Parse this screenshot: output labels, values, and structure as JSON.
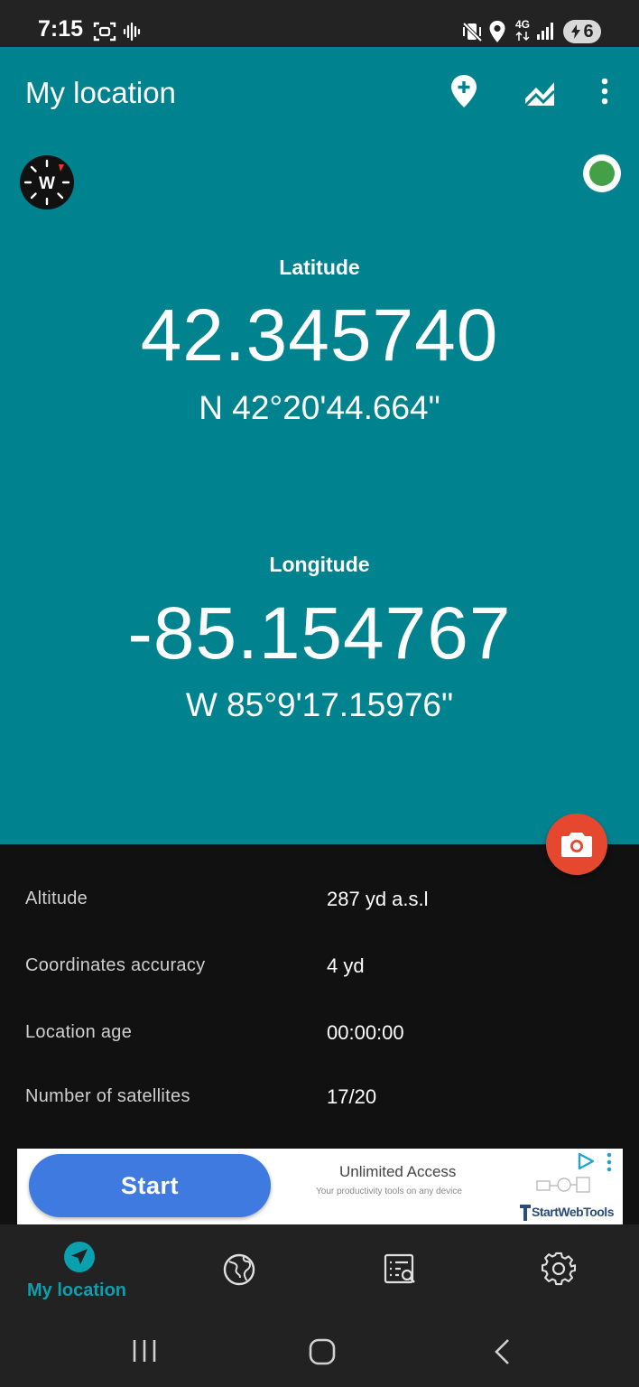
{
  "status_bar": {
    "time": "7:15",
    "battery": "6",
    "network": "4G",
    "icons": [
      "screenshot-icon",
      "voice-recorder-icon",
      "vibrate-mute-icon",
      "location-pin-icon",
      "signal-icon",
      "battery-charging-icon"
    ]
  },
  "toolbar": {
    "title": "My location",
    "actions": [
      "add-location-icon",
      "chart-icon",
      "more-vert-icon"
    ]
  },
  "compass": {
    "direction": "W"
  },
  "coordinates": {
    "latitude_label": "Latitude",
    "latitude": "42.345740",
    "latitude_dms": "N 42°20'44.664\"",
    "longitude_label": "Longitude",
    "longitude": "-85.154767",
    "longitude_dms": "W 85°9'17.15976\""
  },
  "details": [
    {
      "label": "Altitude",
      "value": "287 yd a.s.l"
    },
    {
      "label": "Coordinates accuracy",
      "value": "4 yd"
    },
    {
      "label": "Location age",
      "value": "00:00:00"
    },
    {
      "label": "Number of satellites",
      "value": "17/20"
    }
  ],
  "ad": {
    "button": "Start",
    "headline": "Unlimited Access",
    "subline": "Your productivity tools on any device",
    "brand": "StartWebTools"
  },
  "bottom_nav": {
    "items": [
      {
        "label": "My location",
        "icon": "navigation-arrow-icon",
        "active": true
      },
      {
        "icon": "globe-icon"
      },
      {
        "icon": "list-search-icon"
      },
      {
        "icon": "gear-icon"
      }
    ]
  },
  "colors": {
    "primary": "#00838f",
    "accent": "#0aa0ae",
    "fab": "#e5482f",
    "fix_status": "#43a047",
    "ad_button": "#3f7ae0"
  }
}
